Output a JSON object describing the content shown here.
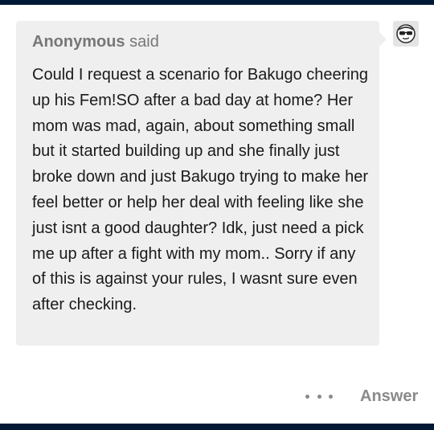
{
  "ask": {
    "asker_name": "Anonymous",
    "asker_suffix": "said",
    "question_text": "Could I request a scenario for Bakugo cheering up his Fem!SO after a bad day at home? Her mom was mad, again, about something small but it started building up and she finally just broke down and just Bakugo trying to make her feel better or help her deal with feeling like she just isnt a good daughter? Idk, just need a pick me up after a fight with my mom.. Sorry if any of this is against your rules, I wasnt sure even after checking."
  },
  "avatar": {
    "icon": "anonymous-sunglasses-icon"
  },
  "actions": {
    "more_icon": "ellipsis-icon",
    "answer_label": "Answer"
  },
  "colors": {
    "frame": "#001935",
    "bubble": "#efefef",
    "muted_text": "#777777",
    "body_text": "#1a1a1a",
    "action_text": "#8a8a8a"
  }
}
